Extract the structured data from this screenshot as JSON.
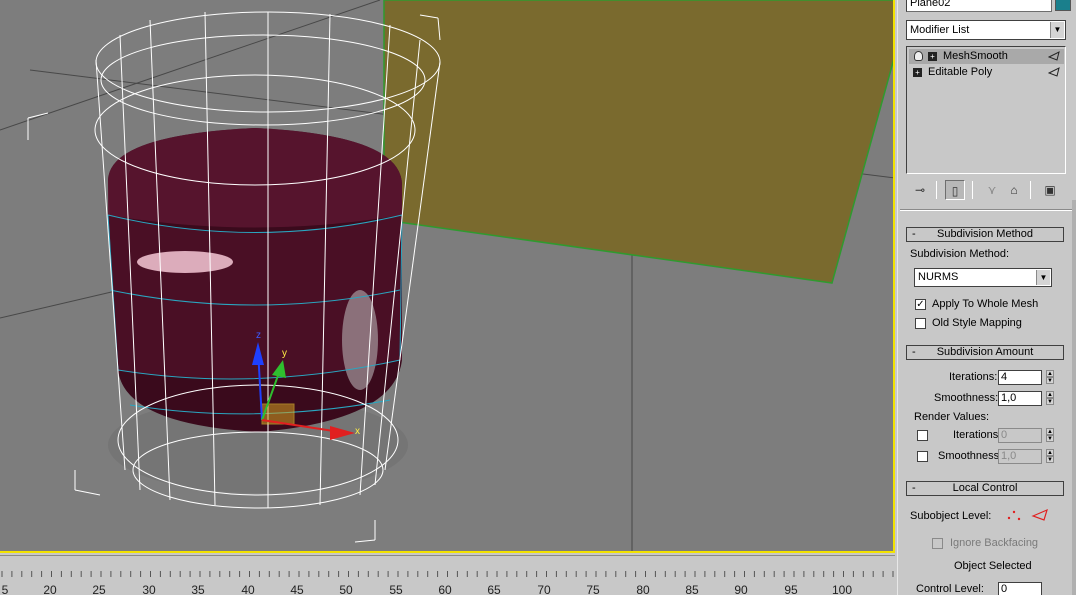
{
  "object_name": "Plane02",
  "colors": {
    "object_swatch": "#1a7f8c",
    "viewport_border": "#f2e200",
    "plane": "#7a6a2e",
    "cup_inner": "#3a0a1c"
  },
  "modifier_list": {
    "label": "Modifier List"
  },
  "stack": [
    {
      "label": "MeshSmooth",
      "selected": true
    },
    {
      "label": "Editable Poly",
      "selected": false
    }
  ],
  "stack_tools": {
    "icons": [
      "pin-stack-icon",
      "show-end-result-icon",
      "make-unique-icon",
      "remove-modifier-icon",
      "configure-modifier-sets-icon"
    ]
  },
  "subdivision_method": {
    "rollout_title": "Subdivision Method",
    "method_label": "Subdivision Method:",
    "method_value": "NURMS",
    "apply_whole_mesh": {
      "label": "Apply To Whole Mesh",
      "checked": true
    },
    "old_style_mapping": {
      "label": "Old Style Mapping",
      "checked": false
    }
  },
  "subdivision_amount": {
    "rollout_title": "Subdivision Amount",
    "iterations_label": "Iterations:",
    "iterations_value": "4",
    "smoothness_label": "Smoothness:",
    "smoothness_value": "1,0",
    "render_values_label": "Render Values:",
    "render_iterations_label": "Iterations:",
    "render_iterations_value": "0",
    "render_smoothness_label": "Smoothness:",
    "render_smoothness_value": "1,0"
  },
  "local_control": {
    "rollout_title": "Local Control",
    "subobject_label": "Subobject Level:",
    "ignore_backfacing": "Ignore Backfacing",
    "status": "Object Selected",
    "control_level_label": "Control Level:",
    "control_level_value": "0"
  },
  "gizmo_labels": {
    "x": "x",
    "y": "y",
    "z": "z"
  },
  "ruler_ticks": [
    "5",
    "20",
    "25",
    "30",
    "35",
    "40",
    "45",
    "50",
    "55",
    "60",
    "65",
    "70",
    "75",
    "80",
    "85",
    "90",
    "95",
    "100"
  ]
}
